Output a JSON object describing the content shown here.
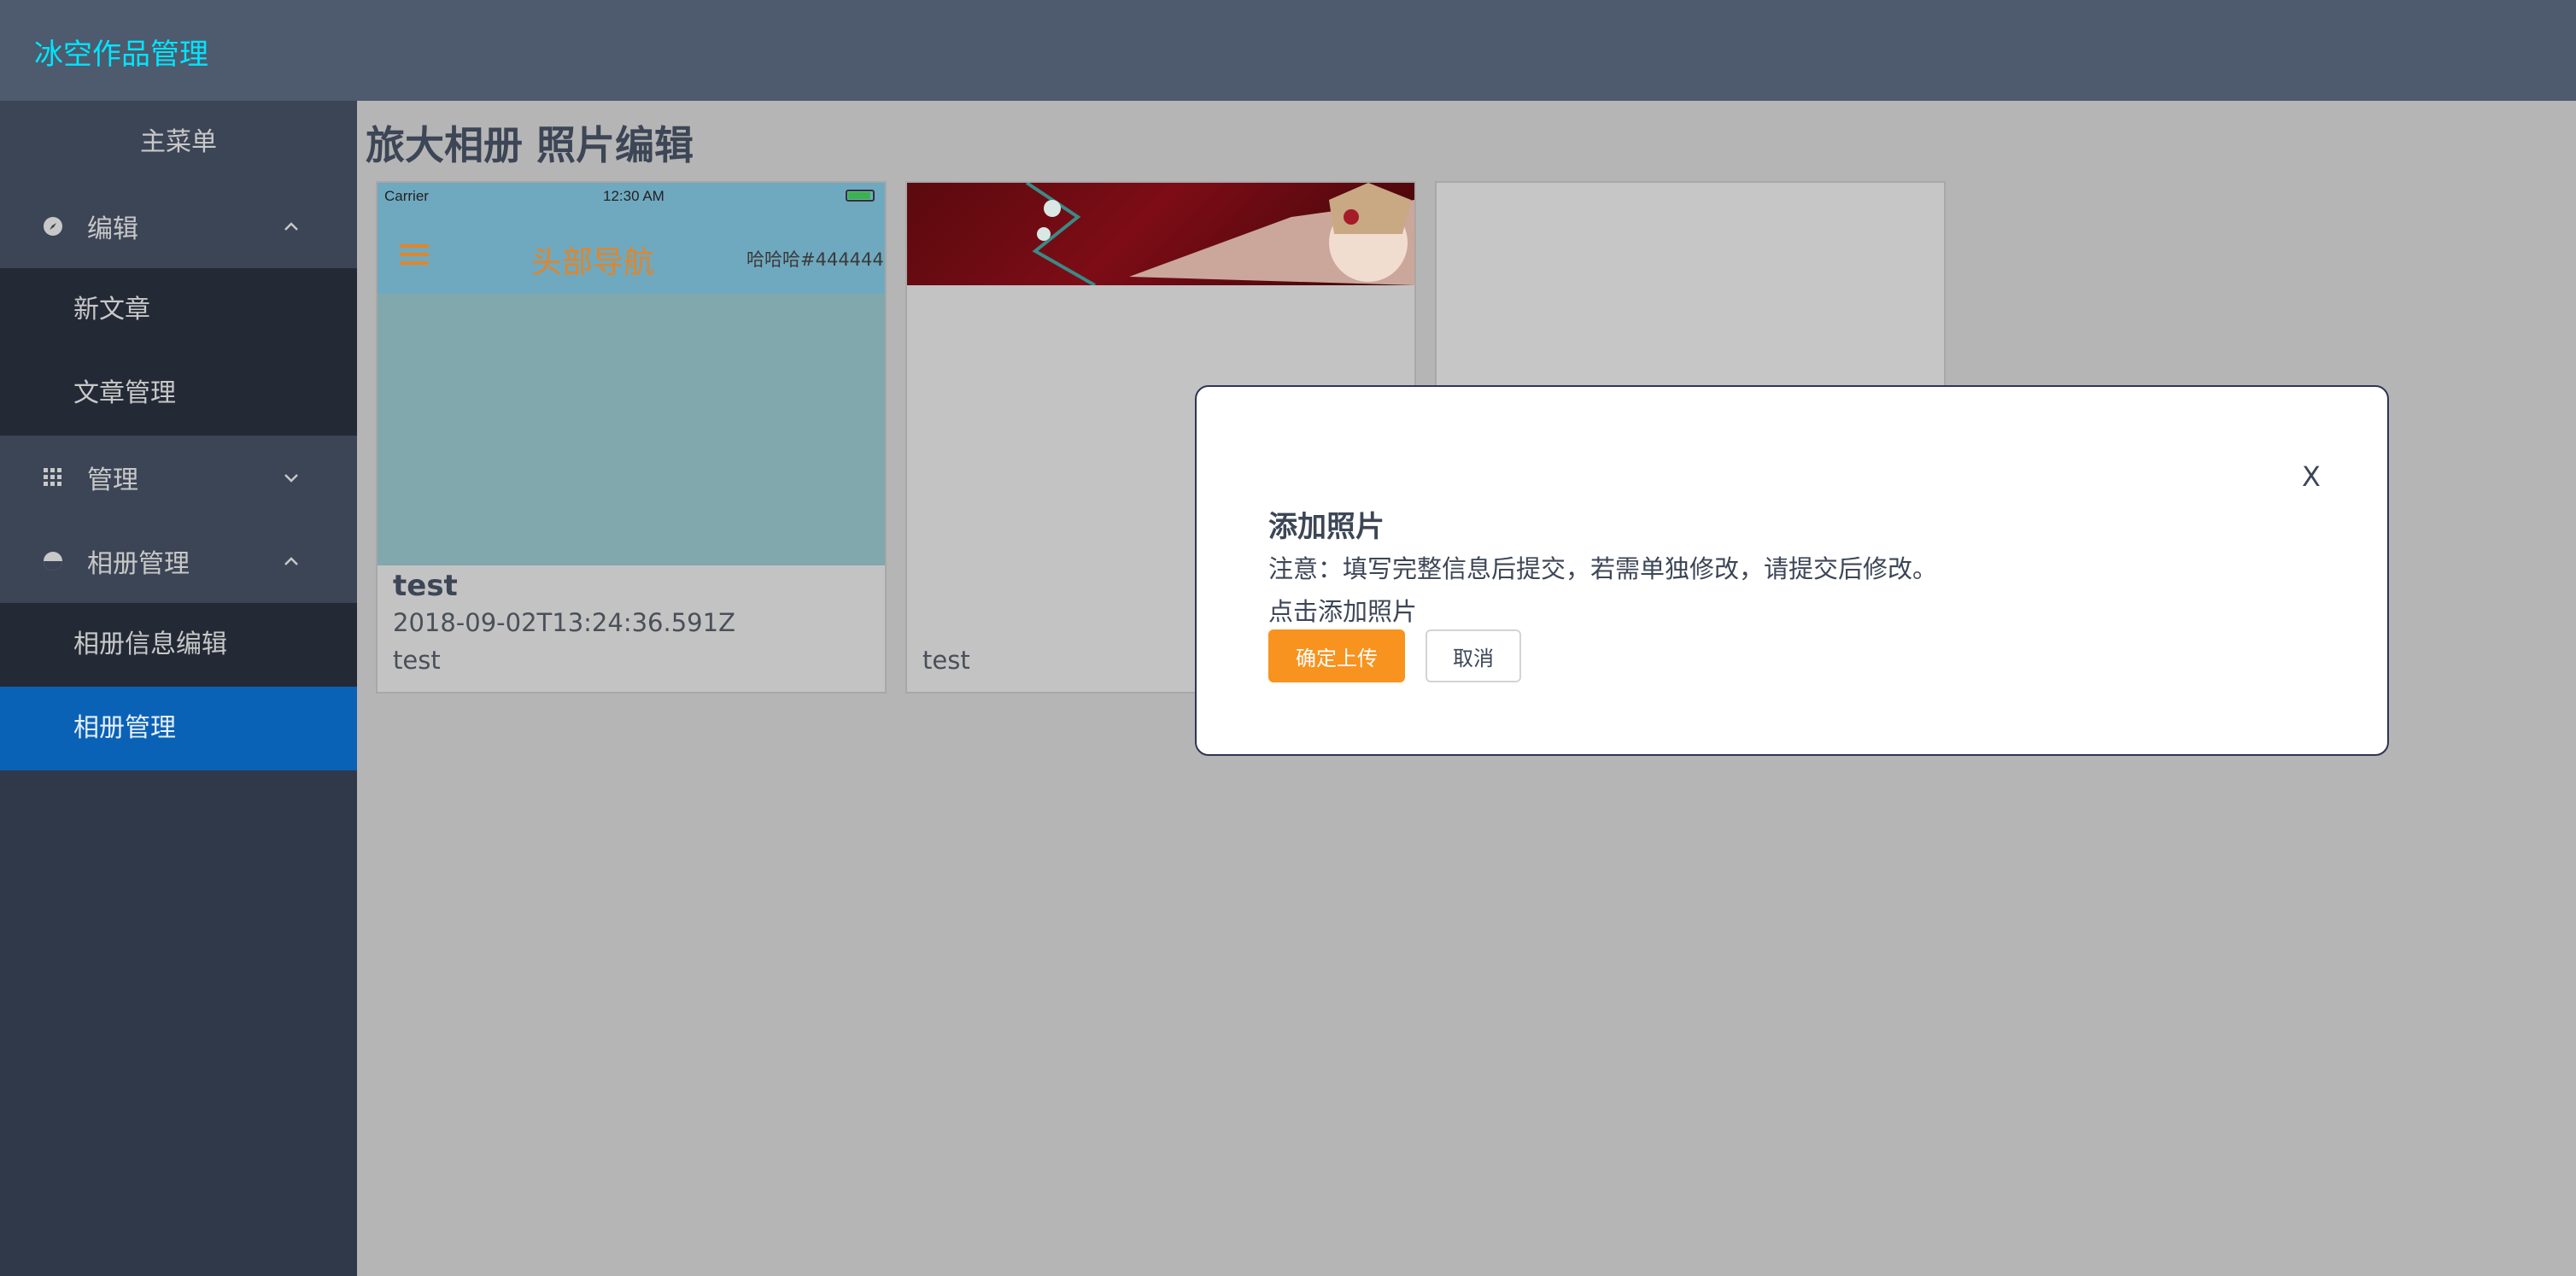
{
  "app": {
    "brand": "冰空作品管理"
  },
  "sidebar": {
    "menu_title": "主菜单",
    "groups": [
      {
        "label": "编辑",
        "icon": "compass-icon",
        "expanded": true,
        "items": [
          {
            "label": "新文章"
          },
          {
            "label": "文章管理"
          }
        ]
      },
      {
        "label": "管理",
        "icon": "grid-icon",
        "expanded": false,
        "items": []
      },
      {
        "label": "相册管理",
        "icon": "pie-icon",
        "expanded": true,
        "items": [
          {
            "label": "相册信息编辑"
          },
          {
            "label": "相册管理",
            "active": true
          }
        ]
      }
    ]
  },
  "main": {
    "page_title": "旅大相册 照片编辑",
    "cards": [
      {
        "title": "test",
        "date": "2018-09-02T13:24:36.591Z",
        "desc": "test",
        "phone": {
          "carrier": "Carrier",
          "time": "12:30 AM",
          "nav_title": "头部导航",
          "nav_right": "哈哈哈#444444"
        }
      },
      {
        "title": "",
        "date": "",
        "desc": "test"
      },
      {
        "title": "",
        "date": "",
        "desc": ""
      }
    ]
  },
  "modal": {
    "close_label": "X",
    "title": "添加照片",
    "note": "注意：填写完整信息后提交，若需单独修改，请提交后修改。",
    "add_link": "点击添加照片",
    "ok_label": "确定上传",
    "cancel_label": "取消"
  },
  "colors": {
    "topbar": "#4e5a6d",
    "brand": "#00e5ff",
    "sidebar": "#30394a",
    "active_item": "#0a62b6",
    "primary_button": "#f7931e"
  }
}
